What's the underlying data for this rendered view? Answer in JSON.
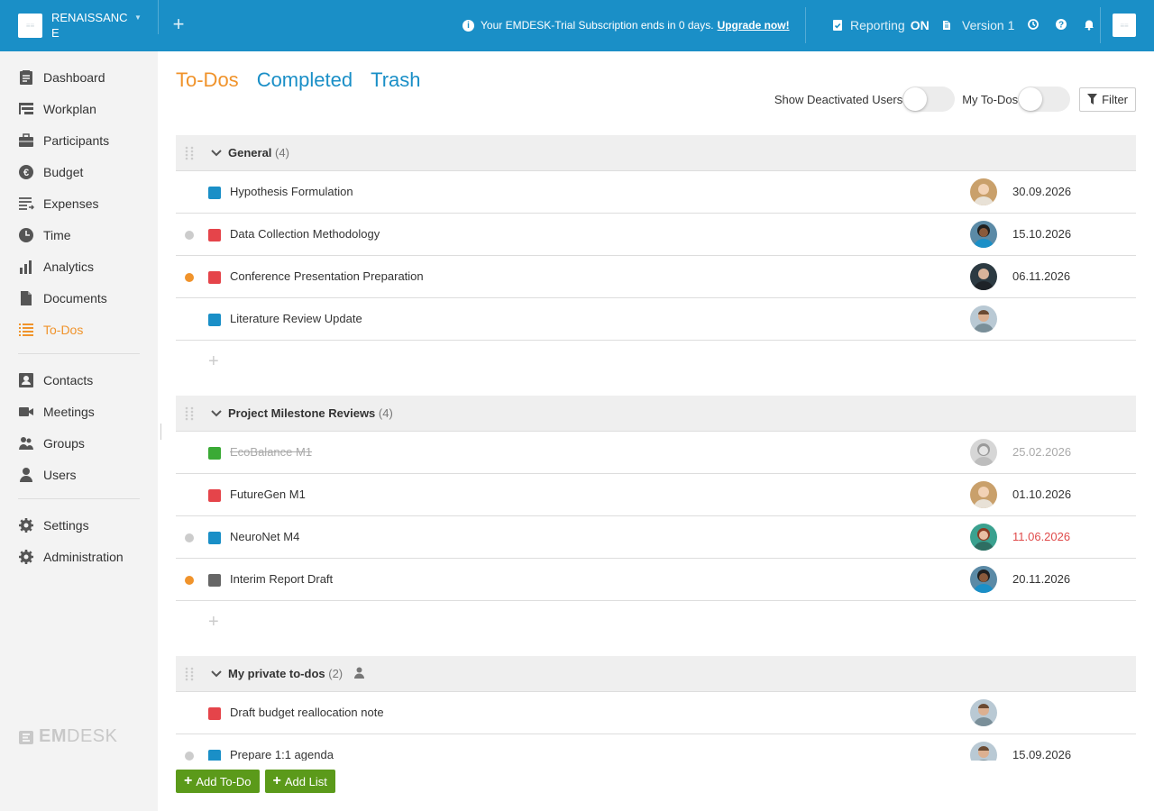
{
  "header": {
    "org_name": "RENAISSANCE",
    "logo_text": "≡≡",
    "trial_text": "Your EMDESK-Trial Subscription ends in 0 days.",
    "upgrade_link": "Upgrade now!",
    "reporting_label": "Reporting",
    "reporting_state": "ON",
    "version_label": "Version 1"
  },
  "sidebar": {
    "items": [
      {
        "label": "Dashboard",
        "icon": "clipboard-icon"
      },
      {
        "label": "Workplan",
        "icon": "workplan-icon"
      },
      {
        "label": "Participants",
        "icon": "briefcase-icon"
      },
      {
        "label": "Budget",
        "icon": "euro-icon"
      },
      {
        "label": "Expenses",
        "icon": "expenses-icon"
      },
      {
        "label": "Time",
        "icon": "clock-icon"
      },
      {
        "label": "Analytics",
        "icon": "bar-chart-icon"
      },
      {
        "label": "Documents",
        "icon": "document-icon"
      },
      {
        "label": "To-Dos",
        "icon": "list-icon",
        "active": true
      },
      {
        "label": "Contacts",
        "icon": "contact-icon"
      },
      {
        "label": "Meetings",
        "icon": "video-icon"
      },
      {
        "label": "Groups",
        "icon": "group-icon"
      },
      {
        "label": "Users",
        "icon": "user-icon"
      },
      {
        "label": "Settings",
        "icon": "gear-icon"
      },
      {
        "label": "Administration",
        "icon": "gear-icon"
      }
    ],
    "brand": {
      "bold": "EM",
      "rest": "DESK"
    }
  },
  "tabs": [
    {
      "label": "To-Dos",
      "active": true
    },
    {
      "label": "Completed",
      "active": false
    },
    {
      "label": "Trash",
      "active": false
    }
  ],
  "controls": {
    "show_deactivated_label": "Show Deactivated Users",
    "my_todos_label": "My To-Dos",
    "filter_label": "Filter"
  },
  "groups": [
    {
      "title": "General",
      "count": "(4)",
      "items": [
        {
          "title": "Hypothesis Formulation",
          "color": "#1a8fc7",
          "dot": "",
          "date": "30.09.2026",
          "date_state": "normal",
          "avatar": "#c9a06b"
        },
        {
          "title": "Data Collection Methodology",
          "color": "#e5444a",
          "dot": "#ccc",
          "date": "15.10.2026",
          "date_state": "normal",
          "avatar": "#3a6b8c"
        },
        {
          "title": "Conference Presentation Preparation",
          "color": "#e5444a",
          "dot": "#f0932b",
          "date": "06.11.2026",
          "date_state": "normal",
          "avatar": "#2c3a42"
        },
        {
          "title": "Literature Review Update",
          "color": "#1a8fc7",
          "dot": "",
          "date": "",
          "date_state": "normal",
          "avatar": "#a4795a"
        }
      ]
    },
    {
      "title": "Project Milestone Reviews",
      "count": "(4)",
      "items": [
        {
          "title": "EcoBalance M1",
          "color": "#3aaa35",
          "dot": "",
          "date": "25.02.2026",
          "date_state": "faded",
          "done": true,
          "avatar": "#cfcfcf"
        },
        {
          "title": "FutureGen M1",
          "color": "#e5444a",
          "dot": "",
          "date": "01.10.2026",
          "date_state": "normal",
          "avatar": "#c9a06b"
        },
        {
          "title": "NeuroNet M4",
          "color": "#1a8fc7",
          "dot": "#ccc",
          "date": "11.06.2026",
          "date_state": "overdue",
          "avatar": "#8a4a3a"
        },
        {
          "title": "Interim Report Draft",
          "color": "#666666",
          "dot": "#f0932b",
          "date": "20.11.2026",
          "date_state": "normal",
          "avatar": "#3a6b8c"
        }
      ]
    },
    {
      "title": "My private to-dos",
      "count": "(2)",
      "private": true,
      "items": [
        {
          "title": "Draft budget reallocation note",
          "color": "#e5444a",
          "dot": "",
          "date": "",
          "date_state": "normal",
          "avatar": "#a4795a"
        },
        {
          "title": "Prepare 1:1 agenda",
          "color": "#1a8fc7",
          "dot": "#ccc",
          "date": "15.09.2026",
          "date_state": "normal",
          "avatar": "#a4795a"
        }
      ]
    }
  ],
  "footer": {
    "add_todo": "Add To-Do",
    "add_list": "Add List"
  }
}
